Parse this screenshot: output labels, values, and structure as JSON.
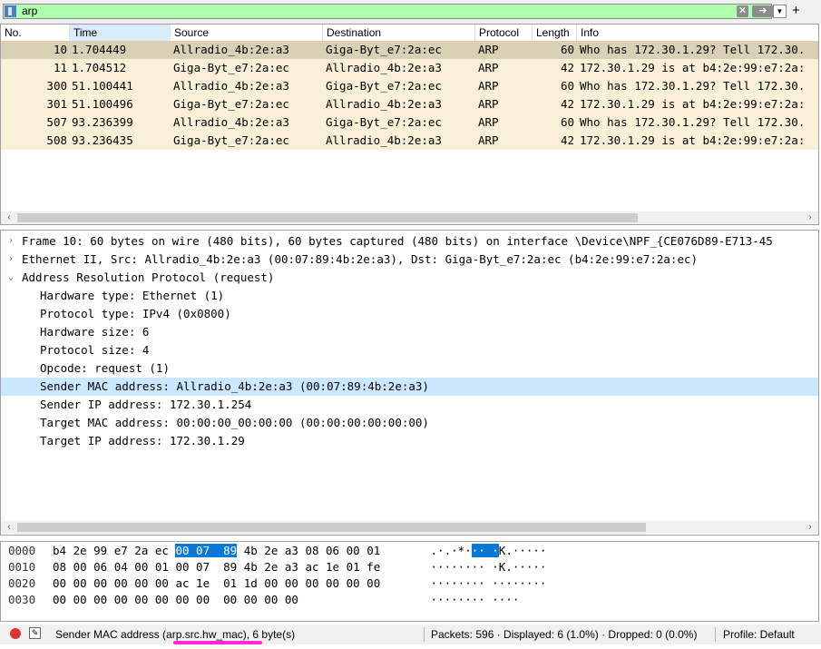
{
  "filter": {
    "value": "arp"
  },
  "columns": [
    "No.",
    "Time",
    "Source",
    "Destination",
    "Protocol",
    "Length",
    "Info"
  ],
  "packets": [
    {
      "no": "10",
      "time": "1.704449",
      "src": "Allradio_4b:2e:a3",
      "dst": "Giga-Byt_e7:2a:ec",
      "proto": "ARP",
      "len": "60",
      "info": "Who has 172.30.1.29? Tell 172.30.",
      "selected": true
    },
    {
      "no": "11",
      "time": "1.704512",
      "src": "Giga-Byt_e7:2a:ec",
      "dst": "Allradio_4b:2e:a3",
      "proto": "ARP",
      "len": "42",
      "info": "172.30.1.29 is at b4:2e:99:e7:2a:"
    },
    {
      "no": "300",
      "time": "51.100441",
      "src": "Allradio_4b:2e:a3",
      "dst": "Giga-Byt_e7:2a:ec",
      "proto": "ARP",
      "len": "60",
      "info": "Who has 172.30.1.29? Tell 172.30."
    },
    {
      "no": "301",
      "time": "51.100496",
      "src": "Giga-Byt_e7:2a:ec",
      "dst": "Allradio_4b:2e:a3",
      "proto": "ARP",
      "len": "42",
      "info": "172.30.1.29 is at b4:2e:99:e7:2a:"
    },
    {
      "no": "507",
      "time": "93.236399",
      "src": "Allradio_4b:2e:a3",
      "dst": "Giga-Byt_e7:2a:ec",
      "proto": "ARP",
      "len": "60",
      "info": "Who has 172.30.1.29? Tell 172.30."
    },
    {
      "no": "508",
      "time": "93.236435",
      "src": "Giga-Byt_e7:2a:ec",
      "dst": "Allradio_4b:2e:a3",
      "proto": "ARP",
      "len": "42",
      "info": "172.30.1.29 is at b4:2e:99:e7:2a:"
    }
  ],
  "details": [
    {
      "text": "Frame 10: 60 bytes on wire (480 bits), 60 bytes captured (480 bits) on interface \\Device\\NPF_{CE076D89-E713-45",
      "level": 0,
      "chevron": "›"
    },
    {
      "text": "Ethernet II, Src: Allradio_4b:2e:a3 (00:07:89:4b:2e:a3), Dst: Giga-Byt_e7:2a:ec (b4:2e:99:e7:2a:ec)",
      "level": 0,
      "chevron": "›"
    },
    {
      "text": "Address Resolution Protocol (request)",
      "level": 0,
      "chevron": "⌄"
    },
    {
      "text": "Hardware type: Ethernet (1)",
      "level": 1
    },
    {
      "text": "Protocol type: IPv4 (0x0800)",
      "level": 1
    },
    {
      "text": "Hardware size: 6",
      "level": 1
    },
    {
      "text": "Protocol size: 4",
      "level": 1
    },
    {
      "text": "Opcode: request (1)",
      "level": 1
    },
    {
      "text": "Sender MAC address: Allradio_4b:2e:a3 (00:07:89:4b:2e:a3)",
      "level": 1,
      "highlight": true
    },
    {
      "text": "Sender IP address: 172.30.1.254",
      "level": 1
    },
    {
      "text": "Target MAC address: 00:00:00_00:00:00 (00:00:00:00:00:00)",
      "level": 1
    },
    {
      "text": "Target IP address: 172.30.1.29",
      "level": 1
    }
  ],
  "bytes": [
    {
      "offset": "0000",
      "hex_pre": "b4 2e 99 e7 2a ec ",
      "hex_hl": "00 07  89",
      "hex_post": " 4b 2e a3 08 06 00 01",
      "asc_pre": " .·.·*·",
      "asc_hl": "·· ·",
      "asc_post": "K.·····"
    },
    {
      "offset": "0010",
      "hex_pre": "08 00 06 04 00 01 00 07  89 4b 2e a3 ac 1e 01 fe",
      "hex_hl": "",
      "hex_post": "",
      "asc_pre": " ········ ·K.·····",
      "asc_hl": "",
      "asc_post": ""
    },
    {
      "offset": "0020",
      "hex_pre": "00 00 00 00 00 00 ac 1e  01 1d 00 00 00 00 00 00",
      "hex_hl": "",
      "hex_post": "",
      "asc_pre": " ········ ········",
      "asc_hl": "",
      "asc_post": ""
    },
    {
      "offset": "0030",
      "hex_pre": "00 00 00 00 00 00 00 00  00 00 00 00",
      "hex_hl": "",
      "hex_post": "",
      "asc_pre": " ········ ····",
      "asc_hl": "",
      "asc_post": ""
    }
  ],
  "status": {
    "field": "Sender MAC address (arp.src.hw_mac), 6 byte(s)",
    "packets": "Packets: 596 · Displayed: 6 (1.0%) · Dropped: 0 (0.0%)",
    "profile": "Profile: Default"
  },
  "colors": {
    "filter_bg": "#afffaf",
    "row_bg": "#faf0d7",
    "row_selected": "#dad0b6",
    "detail_highlight": "#cce8ff",
    "byte_highlight": "#0a78d7",
    "annotation": "#ff2bd6"
  },
  "icons": [
    "bookmark-icon",
    "clear-icon",
    "apply-arrow-icon",
    "dropdown-icon",
    "plus-icon",
    "stop-icon",
    "edit-icon"
  ]
}
